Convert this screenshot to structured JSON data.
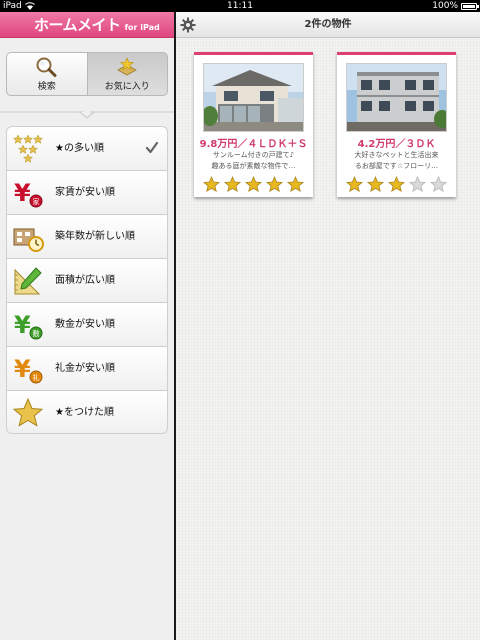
{
  "status_bar": {
    "carrier": "iPad",
    "time": "11:11",
    "battery": "100%"
  },
  "app": {
    "logo_main": "ホームメイト",
    "logo_sub": "for iPad"
  },
  "segments": [
    {
      "label": "検索",
      "icon": "magnifier-icon",
      "selected": false
    },
    {
      "label": "お気に入り",
      "icon": "favorites-icon",
      "selected": true
    }
  ],
  "sort_options": [
    {
      "label": "★の多い順",
      "icon": "stars-icon",
      "checked": true
    },
    {
      "label": "家賃が安い順",
      "icon": "rent-yen-icon",
      "checked": false
    },
    {
      "label": "築年数が新しい順",
      "icon": "building-age-icon",
      "checked": false
    },
    {
      "label": "面積が広い順",
      "icon": "area-ruler-icon",
      "checked": false
    },
    {
      "label": "敷金が安い順",
      "icon": "deposit-yen-icon",
      "checked": false
    },
    {
      "label": "礼金が安い順",
      "icon": "key-money-yen-icon",
      "checked": false
    },
    {
      "label": "★をつけた順",
      "icon": "star-icon",
      "checked": false
    }
  ],
  "right": {
    "title": "2件の物件"
  },
  "properties": [
    {
      "price": "9.8万円／４ＬＤＫ＋Ｓ",
      "desc_line1": "サンルーム付きの戸建て♪",
      "desc_line2": "趣ある庭が素敵な物件で…",
      "rating": 5
    },
    {
      "price": "4.2万円／３ＤＫ",
      "desc_line1": "大好きなペットと生活出来",
      "desc_line2": "るお部屋です☆フローリ…",
      "rating": 3
    }
  ],
  "colors": {
    "brand_pink": "#e0457f",
    "star_gold": "#e8b820",
    "star_empty": "#d8d8d8"
  }
}
